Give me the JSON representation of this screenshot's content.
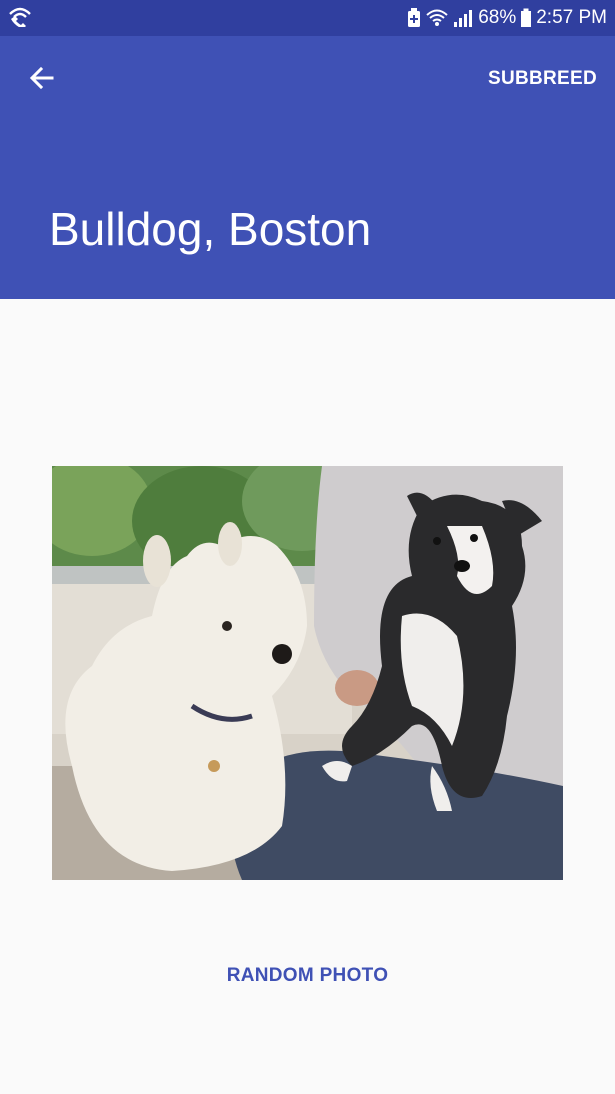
{
  "status_bar": {
    "battery_percent": "68%",
    "time": "2:57 PM",
    "icons": [
      "wifi-calling-icon",
      "battery-saver-icon",
      "wifi-icon",
      "signal-icon",
      "battery-icon"
    ]
  },
  "app_bar": {
    "back_icon": "arrow-left-icon",
    "action_label": "SUBBREED",
    "title": "Bulldog, Boston"
  },
  "main": {
    "photo": "dog-photo",
    "random_button_label": "RANDOM PHOTO"
  },
  "colors": {
    "status_bar": "#303f9f",
    "primary": "#3f51b5",
    "background": "#fafafa"
  }
}
